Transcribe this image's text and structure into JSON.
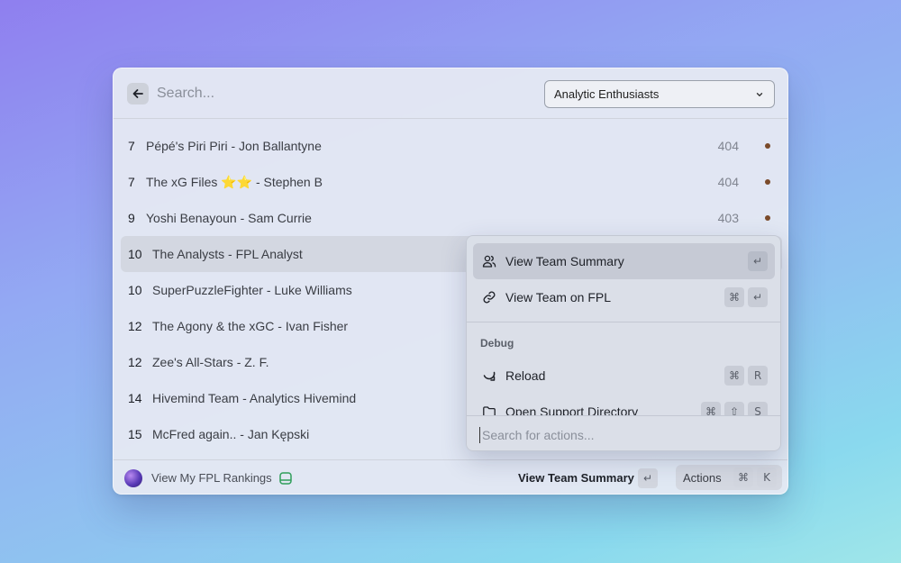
{
  "header": {
    "search_placeholder": "Search...",
    "league_selected": "Analytic Enthusiasts"
  },
  "rows": [
    {
      "rank": "7",
      "name": "Pépé's Piri Piri - Jon Ballantyne",
      "points": "404"
    },
    {
      "rank": "7",
      "name": "The xG Files ⭐⭐ - Stephen B",
      "points": "404"
    },
    {
      "rank": "9",
      "name": "Yoshi Benayoun - Sam Currie",
      "points": "403"
    },
    {
      "rank": "10",
      "name": "The Analysts - FPL Analyst",
      "points": ""
    },
    {
      "rank": "10",
      "name": "SuperPuzzleFighter - Luke Williams",
      "points": ""
    },
    {
      "rank": "12",
      "name": "The Agony & the xGC - Ivan Fisher",
      "points": ""
    },
    {
      "rank": "12",
      "name": "Zee's All-Stars - Z. F.",
      "points": ""
    },
    {
      "rank": "14",
      "name": "Hivemind Team - Analytics Hivemind",
      "points": ""
    },
    {
      "rank": "15",
      "name": "McFred again.. - Jan Kępski",
      "points": ""
    }
  ],
  "footer": {
    "title": "View My FPL Rankings",
    "primary_action": "View Team Summary",
    "enter_key": "↵",
    "actions_label": "Actions",
    "cmd_key": "⌘",
    "k_key": "K"
  },
  "action_panel": {
    "items": [
      {
        "label": "View Team Summary",
        "keys": [
          "↵"
        ]
      },
      {
        "label": "View Team on FPL",
        "keys": [
          "⌘",
          "↵"
        ]
      }
    ],
    "section_title": "Debug",
    "debug_items": [
      {
        "label": "Reload",
        "keys": [
          "⌘",
          "R"
        ]
      },
      {
        "label": "Open Support Directory",
        "keys": [
          "⌘",
          "⇧",
          "S"
        ]
      }
    ],
    "search_placeholder": "Search for actions..."
  },
  "colors": {
    "dot": "#7a4a2a",
    "selected_row": "#d3d7e1",
    "footer_icon": "#2f9e5a"
  }
}
